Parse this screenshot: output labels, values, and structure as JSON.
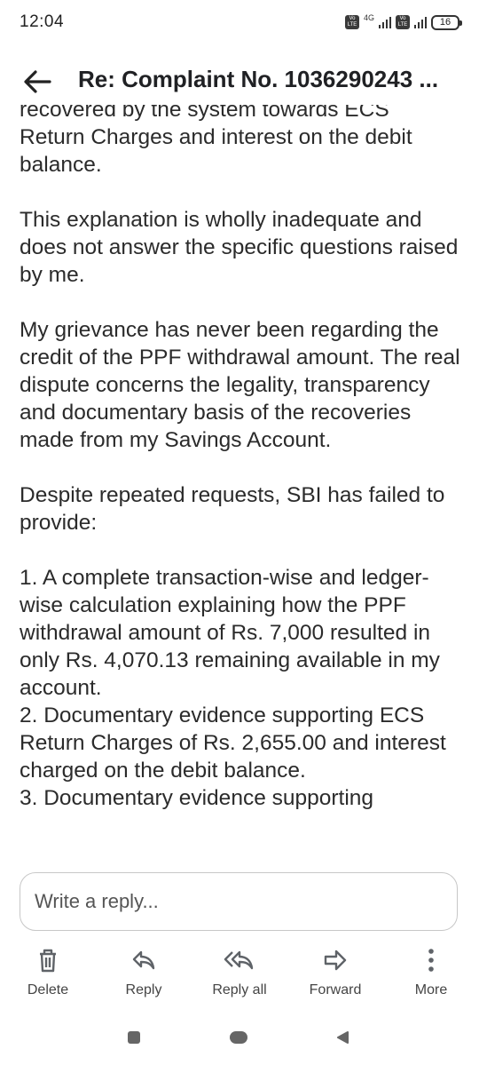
{
  "status_bar": {
    "time": "12:04",
    "network_label": "4G",
    "volte_label": "Vo LTE",
    "battery": "16"
  },
  "header": {
    "title": "Re: Complaint No. 1036290243 ..."
  },
  "email_body": {
    "partial_top_line": "recovered by the system towards ECS",
    "paragraphs": [
      "Return Charges and interest on the debit balance.",
      "This explanation is wholly inadequate and does not answer the specific questions raised by me.",
      "My grievance has never been regarding the credit of the PPF withdrawal amount. The real dispute concerns the legality, transparency and documentary basis of the recoveries made from my Savings Account.",
      "Despite repeated requests, SBI has failed to provide:"
    ],
    "list_items": [
      "1. A complete transaction-wise and ledger-wise calculation explaining how the PPF withdrawal amount of Rs. 7,000 resulted in only Rs. 4,070.13 remaining available in my account.",
      "2. Documentary evidence supporting ECS Return Charges of Rs. 2,655.00 and interest charged on the debit balance.",
      "3. Documentary evidence supporting"
    ]
  },
  "reply": {
    "placeholder": "Write a reply..."
  },
  "actions": {
    "delete": "Delete",
    "reply": "Reply",
    "reply_all": "Reply all",
    "forward": "Forward",
    "more": "More"
  },
  "icons": {
    "back": "arrow-back-icon",
    "delete": "trash-icon",
    "reply": "reply-icon",
    "reply_all": "reply-all-icon",
    "forward": "forward-icon",
    "more": "more-vert-icon"
  },
  "colors": {
    "text": "#2b2b2b",
    "title": "#202124",
    "icon": "#5f6368",
    "border": "#c7c7c7"
  }
}
